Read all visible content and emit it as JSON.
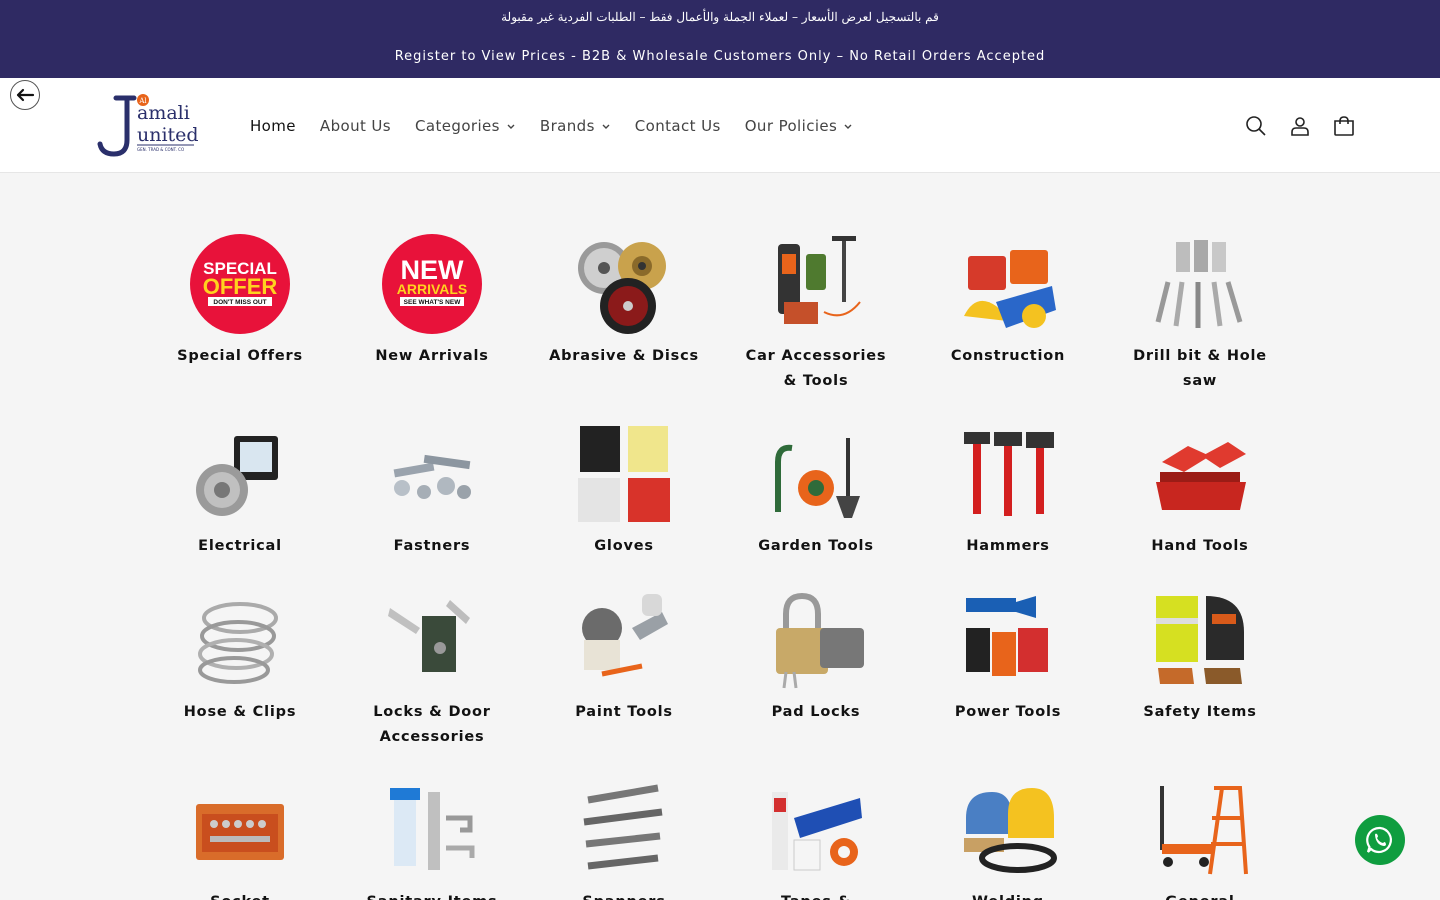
{
  "announcement": {
    "arabic": "قم بالتسجيل لعرض الأسعار – لعملاء الجملة والأعمال فقط – الطلبات الفردية غير مقبولة",
    "english": "Register to View Prices - B2B & Wholesale Customers Only – No Retail Orders Accepted"
  },
  "logo": {
    "al": "Al",
    "jamali": "amali",
    "united": "united",
    "tagline": "GEN. TRAD & CONT. CO"
  },
  "nav": [
    {
      "label": "Home",
      "dropdown": false
    },
    {
      "label": "About Us",
      "dropdown": false
    },
    {
      "label": "Categories",
      "dropdown": true
    },
    {
      "label": "Brands",
      "dropdown": true
    },
    {
      "label": "Contact Us",
      "dropdown": false
    },
    {
      "label": "Our Policies",
      "dropdown": true
    }
  ],
  "header_icons": [
    "search-icon",
    "account-icon",
    "cart-icon"
  ],
  "categories": [
    {
      "label": "Special Offers",
      "icon": "special-offer-badge"
    },
    {
      "label": "New Arrivals",
      "icon": "new-arrivals-badge"
    },
    {
      "label": "Abrasive & Discs",
      "icon": "abrasive-discs-image"
    },
    {
      "label": "Car Accessories & Tools",
      "icon": "car-accessories-image"
    },
    {
      "label": "Construction",
      "icon": "construction-image"
    },
    {
      "label": "Drill bit & Hole saw",
      "icon": "drill-bit-image"
    },
    {
      "label": "Electrical",
      "icon": "electrical-image"
    },
    {
      "label": "Fastners",
      "icon": "fasteners-image"
    },
    {
      "label": "Gloves",
      "icon": "gloves-image"
    },
    {
      "label": "Garden Tools",
      "icon": "garden-tools-image"
    },
    {
      "label": "Hammers",
      "icon": "hammers-image"
    },
    {
      "label": "Hand Tools",
      "icon": "hand-tools-image"
    },
    {
      "label": "Hose & Clips",
      "icon": "hose-clips-image"
    },
    {
      "label": "Locks & Door Accessories",
      "icon": "locks-door-image"
    },
    {
      "label": "Paint Tools",
      "icon": "paint-tools-image"
    },
    {
      "label": "Pad Locks",
      "icon": "pad-locks-image"
    },
    {
      "label": "Power Tools",
      "icon": "power-tools-image"
    },
    {
      "label": "Safety Items",
      "icon": "safety-items-image"
    },
    {
      "label": "Socket",
      "icon": "socket-set-image"
    },
    {
      "label": "Sanitary Items",
      "icon": "sanitary-items-image"
    },
    {
      "label": "Spanners",
      "icon": "spanners-image"
    },
    {
      "label": "Tapes & Adhesives",
      "icon": "tapes-adhesives-image"
    },
    {
      "label": "Welding Electrode",
      "icon": "welding-image"
    },
    {
      "label": "General",
      "icon": "general-image"
    }
  ],
  "badges": {
    "special": {
      "line1": "SPECIAL",
      "line2": "OFFER",
      "line3": "DON'T MISS OUT"
    },
    "new": {
      "line1": "NEW",
      "line2": "ARRIVALS",
      "line3": "SEE WHAT'S NEW"
    }
  },
  "colors": {
    "announcement_bg": "#2f2a63",
    "brand_navy": "#2a2f6b",
    "brand_orange": "#e8641b",
    "whatsapp": "#0f9d3f",
    "badge_red": "#e8123a"
  }
}
